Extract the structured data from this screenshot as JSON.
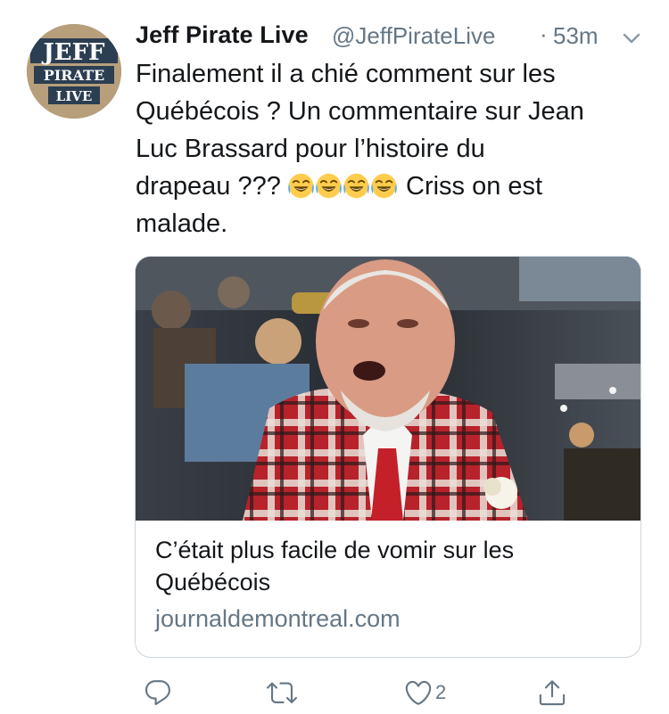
{
  "tweet": {
    "display_name": "Jeff Pirate Live",
    "handle": "@JeffPirateLive",
    "separator": "·",
    "time": "53m",
    "text_lines": [
      "Finalement il a chié comment sur les",
      "Québécois ? Un commentaire sur Jean",
      "Luc Brassard pour l’histoire du",
      "drapeau ???",
      "Criss on est",
      "malade."
    ],
    "emoji": [
      "face-with-tears-of-joy",
      "face-with-tears-of-joy",
      "face-with-tears-of-joy",
      "face-with-tears-of-joy"
    ]
  },
  "avatar": {
    "logo_lines": [
      "JEFF",
      "PIRATE",
      "LIVE"
    ],
    "colors": {
      "primary": "#2b3e52",
      "ring": "#a38e6c"
    }
  },
  "card": {
    "title_lines": [
      "C’était plus facile de vomir sur les",
      "Québécois"
    ],
    "domain": "journaldemontreal.com"
  },
  "actions": {
    "reply_icon": "reply-icon",
    "retweet_icon": "retweet-icon",
    "like_icon": "heart-icon",
    "like_count": "2",
    "share_icon": "share-icon"
  },
  "colors": {
    "text": "#14171a",
    "secondary": "#657786",
    "border": "#ccd6dd"
  }
}
